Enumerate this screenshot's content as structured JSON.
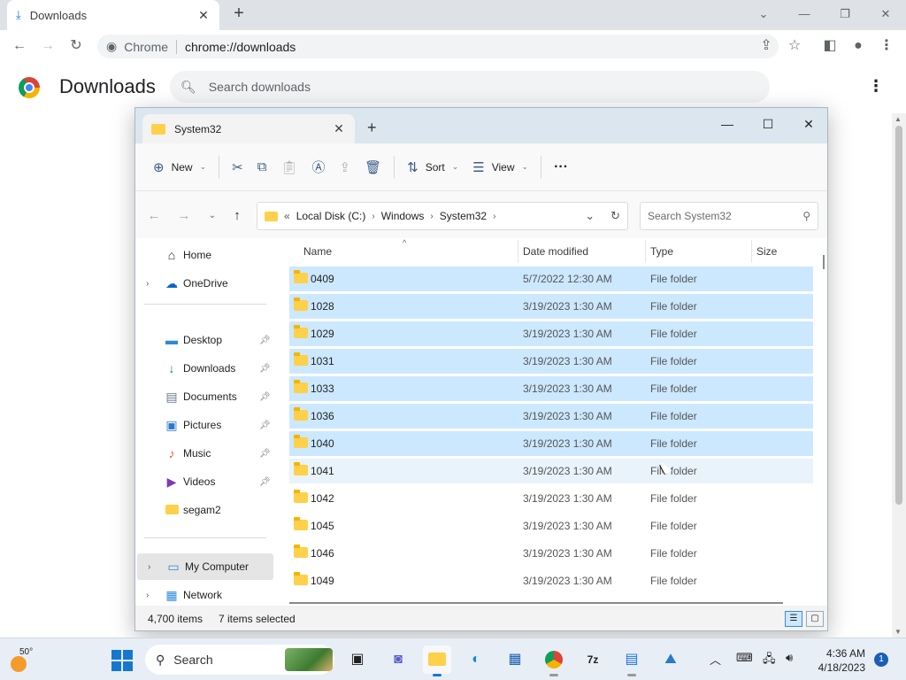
{
  "chrome": {
    "tab_title": "Downloads",
    "new_tab_label": "+",
    "omnibox_chip": "Chrome",
    "omnibox_url": "chrome://downloads",
    "page_title": "Downloads",
    "search_placeholder": "Search downloads"
  },
  "explorer": {
    "tab_title": "System32",
    "new_tab_label": "+",
    "commands": {
      "new": "New",
      "sort": "Sort",
      "view": "View"
    },
    "breadcrumb": [
      "Local Disk (C:)",
      "Windows",
      "System32"
    ],
    "search_placeholder": "Search System32",
    "nav": {
      "home": "Home",
      "onedrive": "OneDrive",
      "desktop": "Desktop",
      "downloads": "Downloads",
      "documents": "Documents",
      "pictures": "Pictures",
      "music": "Music",
      "videos": "Videos",
      "segam2": "segam2",
      "my_computer": "My Computer",
      "network": "Network"
    },
    "columns": {
      "name": "Name",
      "date": "Date modified",
      "type": "Type",
      "size": "Size"
    },
    "rows": [
      {
        "name": "0409",
        "date": "5/7/2022 12:30 AM",
        "type": "File folder",
        "selected": true
      },
      {
        "name": "1028",
        "date": "3/19/2023 1:30 AM",
        "type": "File folder",
        "selected": true
      },
      {
        "name": "1029",
        "date": "3/19/2023 1:30 AM",
        "type": "File folder",
        "selected": true
      },
      {
        "name": "1031",
        "date": "3/19/2023 1:30 AM",
        "type": "File folder",
        "selected": true
      },
      {
        "name": "1033",
        "date": "3/19/2023 1:30 AM",
        "type": "File folder",
        "selected": true
      },
      {
        "name": "1036",
        "date": "3/19/2023 1:30 AM",
        "type": "File folder",
        "selected": true
      },
      {
        "name": "1040",
        "date": "3/19/2023 1:30 AM",
        "type": "File folder",
        "selected": true
      },
      {
        "name": "1041",
        "date": "3/19/2023 1:30 AM",
        "type": "File folder",
        "selected": false
      },
      {
        "name": "1042",
        "date": "3/19/2023 1:30 AM",
        "type": "File folder",
        "selected": false
      },
      {
        "name": "1045",
        "date": "3/19/2023 1:30 AM",
        "type": "File folder",
        "selected": false
      },
      {
        "name": "1046",
        "date": "3/19/2023 1:30 AM",
        "type": "File folder",
        "selected": false
      },
      {
        "name": "1049",
        "date": "3/19/2023 1:30 AM",
        "type": "File folder",
        "selected": false
      }
    ],
    "status": {
      "items": "4,700 items",
      "selected": "7 items selected"
    }
  },
  "taskbar": {
    "weather_temp": "50°",
    "search_label": "Search",
    "time": "4:36 AM",
    "date": "4/18/2023",
    "notification_count": "1"
  },
  "colors": {
    "selection": "#cce8ff",
    "accent": "#1677d2",
    "folder": "#ffd04a"
  }
}
